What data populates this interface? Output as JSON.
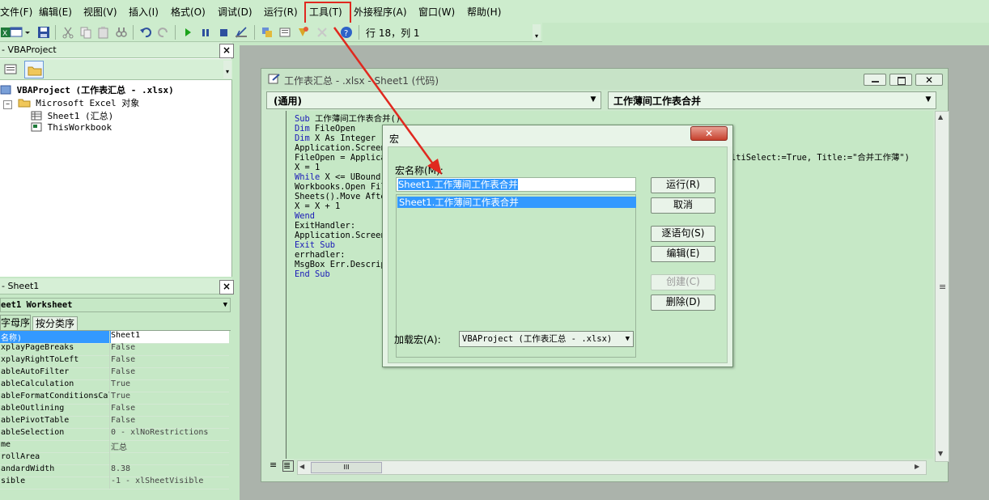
{
  "menu": {
    "items": [
      "文件(F)",
      "编辑(E)",
      "视图(V)",
      "插入(I)",
      "格式(O)",
      "调试(D)",
      "运行(R)",
      "工具(T)",
      "外接程序(A)",
      "窗口(W)",
      "帮助(H)"
    ]
  },
  "toolbar": {
    "position": "行 18，列 1"
  },
  "project": {
    "title": "- VBAProject",
    "root": "VBAProject (工作表汇总 - .xlsx)",
    "folder": "Microsoft Excel 对象",
    "items": [
      "Sheet1 (汇总)",
      "ThisWorkbook"
    ]
  },
  "properties": {
    "title": "- Sheet1",
    "object": "eet1 Worksheet",
    "tabs": [
      "字母序",
      "按分类序"
    ],
    "rows": [
      {
        "name": "名称)",
        "value": "Sheet1"
      },
      {
        "name": "xplayPageBreaks",
        "value": "False"
      },
      {
        "name": "xplayRightToLeft",
        "value": "False"
      },
      {
        "name": "ableAutoFilter",
        "value": "False"
      },
      {
        "name": "ableCalculation",
        "value": "True"
      },
      {
        "name": "ableFormatConditionsCal",
        "value": "True"
      },
      {
        "name": "ableOutlining",
        "value": "False"
      },
      {
        "name": "ablePivotTable",
        "value": "False"
      },
      {
        "name": "ableSelection",
        "value": "0 - xlNoRestrictions"
      },
      {
        "name": "me",
        "value": "汇总"
      },
      {
        "name": "rollArea",
        "value": ""
      },
      {
        "name": "andardWidth",
        "value": "8.38"
      },
      {
        "name": "sible",
        "value": "-1 - xlSheetVisible"
      }
    ]
  },
  "codewindow": {
    "title": "工作表汇总 - .xlsx - Sheet1 (代码)",
    "combo_left": "(通用)",
    "combo_right": "工作薄间工作表合并",
    "lines": [
      {
        "kw": "Sub",
        "text": " 工作薄间工作表合并()"
      },
      {
        "kw": "Dim",
        "text": " FileOpen"
      },
      {
        "kw": "Dim",
        "text": " X As Integer"
      },
      {
        "kw": "",
        "text": "Application.Screen"
      },
      {
        "kw": "",
        "text": "FileOpen = Applica"
      },
      {
        "kw": "",
        "text": "X = 1"
      },
      {
        "kw": "While",
        "text": " X <= UBound("
      },
      {
        "kw": "",
        "text": "Workbooks.Open Fil"
      },
      {
        "kw": "",
        "text": "Sheets().Move Afte"
      },
      {
        "kw": "",
        "text": "X = X + 1"
      },
      {
        "kw": "Wend",
        "text": ""
      },
      {
        "kw": "",
        "text": "ExitHandler:"
      },
      {
        "kw": "",
        "text": "Application.Screen"
      },
      {
        "kw": "Exit Sub",
        "text": ""
      },
      {
        "kw": "",
        "text": "errhadler:"
      },
      {
        "kw": "",
        "text": "MsgBox Err.Descrip"
      },
      {
        "kw": "End Sub",
        "text": ""
      }
    ],
    "line5_tail": "ltiSelect:=True, Title:=\"合并工作薄\")"
  },
  "dialog": {
    "title": "宏",
    "name_label": "宏名称(M):",
    "name_value": "Sheet1.工作薄间工作表合并",
    "list_items": [
      "Sheet1.工作薄间工作表合并"
    ],
    "buttons": {
      "run": "运行(R)",
      "cancel": "取消",
      "step": "逐语句(S)",
      "edit": "编辑(E)",
      "create": "创建(C)",
      "delete": "删除(D)"
    },
    "location_label": "加载宏(A):",
    "location_value": "VBAProject (工作表汇总 - .xlsx)"
  },
  "colors": {
    "highlight": "#3399ff",
    "keyword": "#1a1ab8",
    "annotation": "#e0281f"
  }
}
